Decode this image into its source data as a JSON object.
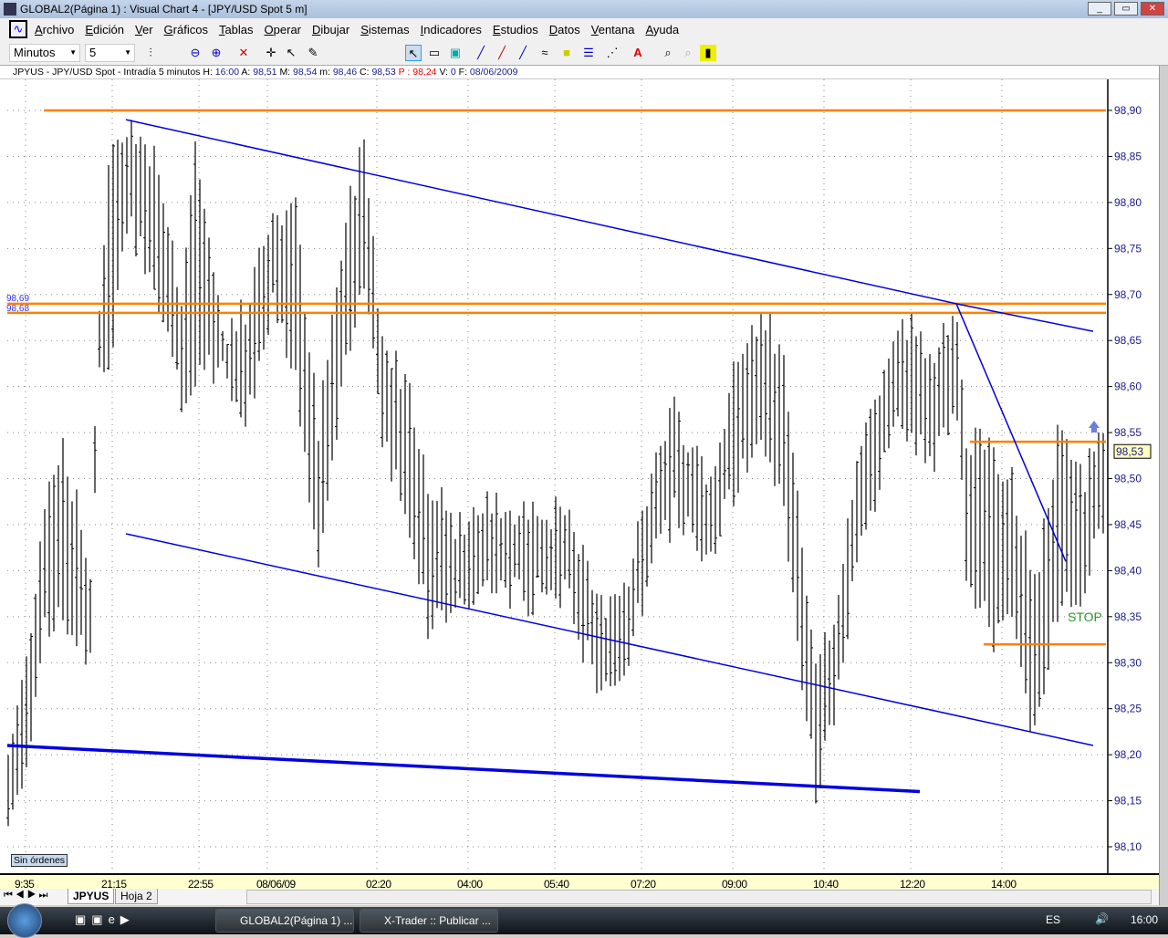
{
  "window": {
    "title": "GLOBAL2(Página 1) : Visual Chart 4 - [JPY/USD Spot 5 m]",
    "buttons": [
      "_",
      "▭",
      "✕"
    ]
  },
  "menu": [
    "Archivo",
    "Edición",
    "Ver",
    "Gráficos",
    "Tablas",
    "Operar",
    "Dibujar",
    "Sistemas",
    "Indicadores",
    "Estudios",
    "Datos",
    "Ventana",
    "Ayuda"
  ],
  "toolbar": {
    "period": "Minutos",
    "interval": "5"
  },
  "info": {
    "symbol": "JPYUS - JPY/USD Spot - Intradía 5 minutos",
    "h_label": "H:",
    "h": "16:00",
    "a_label": "A:",
    "a": "98,51",
    "m_label": "M:",
    "m": "98,54",
    "mn_label": "m:",
    "mn": "98,46",
    "c_label": "C:",
    "c": "98,53",
    "p_label": "P :",
    "p": "98,24",
    "v_label": "V:",
    "v": "0",
    "f_label": "F:",
    "f": "08/06/2009"
  },
  "chart_data": {
    "type": "ohlc",
    "ylim": [
      98.08,
      98.92
    ],
    "yticks": [
      "98,90",
      "98,85",
      "98,80",
      "98,75",
      "98,70",
      "98,65",
      "98,60",
      "98,55",
      "98,50",
      "98,45",
      "98,40",
      "98,35",
      "98,30",
      "98,25",
      "98,20",
      "98,15",
      "98,10"
    ],
    "ytick_values": [
      98.9,
      98.85,
      98.8,
      98.75,
      98.7,
      98.65,
      98.6,
      98.55,
      98.5,
      98.45,
      98.4,
      98.35,
      98.3,
      98.25,
      98.2,
      98.15,
      98.1
    ],
    "bar_count": 241,
    "xticks": [
      {
        "bar": 4,
        "label": "9:35"
      },
      {
        "bar": 23,
        "label": "21:15"
      },
      {
        "bar": 42,
        "label": "22:55"
      },
      {
        "bar": 57,
        "label": "08/06/09"
      },
      {
        "bar": 81,
        "label": "02:20"
      },
      {
        "bar": 101,
        "label": "04:00"
      },
      {
        "bar": 120,
        "label": "05:40"
      },
      {
        "bar": 139,
        "label": "07:20"
      },
      {
        "bar": 159,
        "label": "09:00"
      },
      {
        "bar": 179,
        "label": "10:40"
      },
      {
        "bar": 198,
        "label": "12:20"
      },
      {
        "bar": 218,
        "label": "14:00"
      }
    ],
    "price_path": [
      [
        0,
        98.2,
        98.12
      ],
      [
        4,
        98.3,
        98.2
      ],
      [
        8,
        98.48,
        98.33
      ],
      [
        12,
        98.54,
        98.35
      ],
      [
        18,
        98.4,
        98.3
      ],
      [
        20,
        98.68,
        98.64
      ],
      [
        22,
        98.85,
        98.6
      ],
      [
        26,
        98.89,
        98.78
      ],
      [
        32,
        98.85,
        98.72
      ],
      [
        38,
        98.7,
        98.58
      ],
      [
        41,
        98.86,
        98.6
      ],
      [
        47,
        98.66,
        98.63
      ],
      [
        52,
        98.68,
        98.55
      ],
      [
        58,
        98.79,
        98.7
      ],
      [
        63,
        98.79,
        98.6
      ],
      [
        68,
        98.55,
        98.4
      ],
      [
        74,
        98.78,
        98.62
      ],
      [
        78,
        98.87,
        98.72
      ],
      [
        82,
        98.65,
        98.55
      ],
      [
        88,
        98.6,
        98.45
      ],
      [
        92,
        98.5,
        98.34
      ],
      [
        98,
        98.45,
        98.36
      ],
      [
        106,
        98.47,
        98.38
      ],
      [
        114,
        98.47,
        98.37
      ],
      [
        122,
        98.46,
        98.38
      ],
      [
        130,
        98.36,
        98.26
      ],
      [
        136,
        98.4,
        98.31
      ],
      [
        142,
        98.52,
        98.42
      ],
      [
        146,
        98.57,
        98.46
      ],
      [
        154,
        98.5,
        98.42
      ],
      [
        160,
        98.63,
        98.5
      ],
      [
        166,
        98.68,
        98.53
      ],
      [
        170,
        98.62,
        98.47
      ],
      [
        174,
        98.42,
        98.28
      ],
      [
        177,
        98.28,
        98.16
      ],
      [
        181,
        98.35,
        98.25
      ],
      [
        186,
        98.52,
        98.4
      ],
      [
        194,
        98.65,
        98.55
      ],
      [
        198,
        98.67,
        98.55
      ],
      [
        202,
        98.62,
        98.52
      ],
      [
        208,
        98.69,
        98.56
      ],
      [
        210,
        98.55,
        98.4
      ],
      [
        216,
        98.52,
        98.33
      ],
      [
        220,
        98.5,
        98.34
      ],
      [
        225,
        98.38,
        98.22
      ],
      [
        230,
        98.54,
        98.36
      ],
      [
        236,
        98.5,
        98.38
      ],
      [
        239,
        98.55,
        98.46
      ]
    ],
    "hlines": [
      {
        "price": 98.9,
        "from": 8,
        "to": 241,
        "color": "#ff8000"
      },
      {
        "price": 98.69,
        "from": 0,
        "to": 241,
        "color": "#ff8000",
        "label": "98,69"
      },
      {
        "price": 98.68,
        "from": 0,
        "to": 241,
        "color": "#ff8000",
        "label": "98,68"
      },
      {
        "price": 98.54,
        "from": 211,
        "to": 241,
        "color": "#ff8000"
      },
      {
        "price": 98.32,
        "from": 214,
        "to": 241,
        "color": "#ff8000"
      }
    ],
    "trendlines": [
      {
        "b1": 26,
        "p1": 98.89,
        "b2": 208,
        "p2": 98.69,
        "w": 1.5
      },
      {
        "b1": 208,
        "p1": 98.69,
        "b2": 238,
        "p2": 98.66,
        "w": 1.5
      },
      {
        "b1": 208,
        "p1": 98.69,
        "b2": 232,
        "p2": 98.41,
        "w": 1.5
      },
      {
        "b1": 26,
        "p1": 98.44,
        "b2": 238,
        "p2": 98.21,
        "w": 1.5
      },
      {
        "b1": 0,
        "p1": 98.21,
        "b2": 200,
        "p2": 98.16,
        "w": 3.5
      }
    ],
    "last_price": "98,53",
    "last_value": 98.53,
    "stop_label": "STOP",
    "stop_price": 98.35,
    "colors": {
      "trend": "#0000e0",
      "level": "#ff8000",
      "bar": "#000000",
      "axis_text": "#1a1a8c"
    }
  },
  "orders_label": "Sin órdenes",
  "sheets": [
    "JPYUS",
    "Hoja 2"
  ],
  "taskbar": {
    "tasks": [
      "GLOBAL2(Página 1) ...",
      "X-Trader :: Publicar ..."
    ],
    "lang": "ES",
    "time": "16:00"
  }
}
